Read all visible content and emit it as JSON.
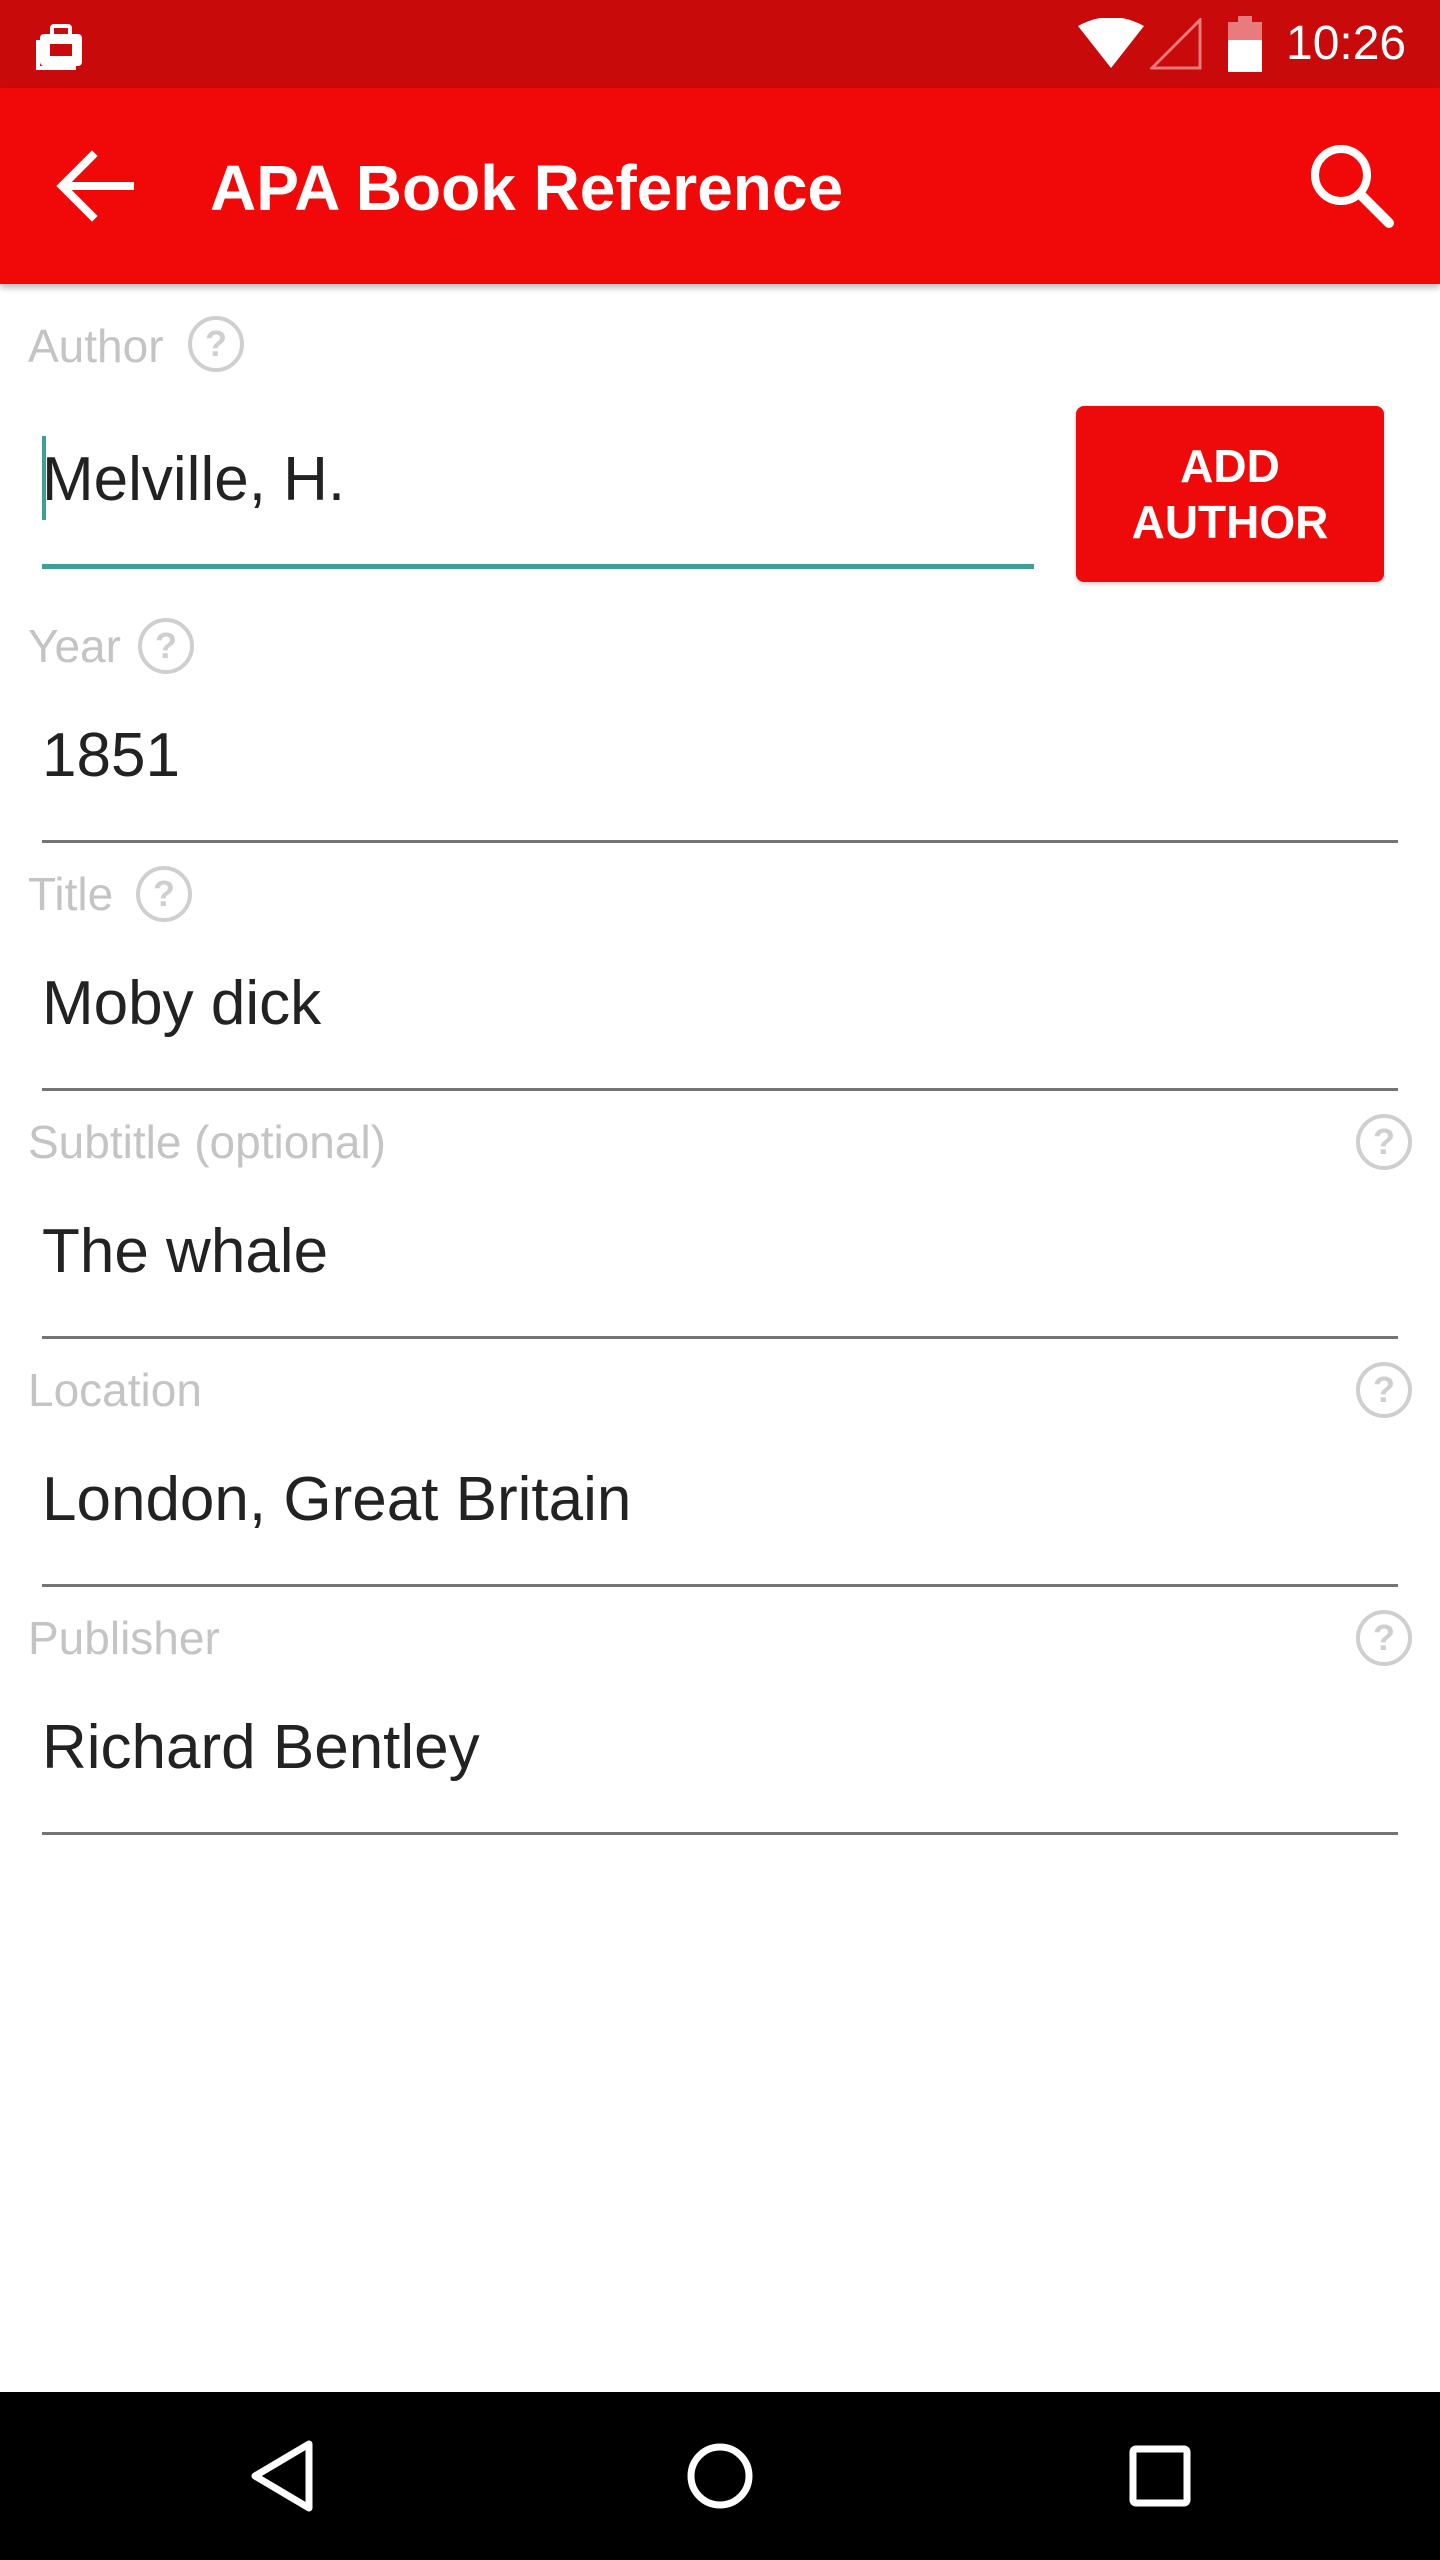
{
  "status_bar": {
    "time": "10:26",
    "icons": [
      "briefcase-notification-icon",
      "wifi-icon",
      "cell-signal-icon",
      "battery-icon"
    ]
  },
  "app_bar": {
    "title": "APA Book Reference",
    "back_icon": "arrow-back-icon",
    "search_icon": "search-icon",
    "background_color": "#f10909",
    "status_color": "#c80a0a"
  },
  "form": {
    "author": {
      "label": "Author",
      "value": "Melville,  H.",
      "help": "?"
    },
    "add_author_button": "ADD AUTHOR",
    "year": {
      "label": "Year",
      "value": "1851",
      "help": "?"
    },
    "title": {
      "label": "Title",
      "value": "Moby dick",
      "help": "?"
    },
    "subtitle": {
      "label": "Subtitle (optional)",
      "value": "The whale",
      "help": "?"
    },
    "location": {
      "label": "Location",
      "value": "London, Great Britain",
      "help": "?"
    },
    "publisher": {
      "label": "Publisher",
      "value": "Richard Bentley",
      "help": "?"
    }
  },
  "nav_bar": {
    "icons": [
      "nav-back-icon",
      "nav-home-icon",
      "nav-recents-icon"
    ]
  },
  "colors": {
    "accent_teal": "#3f9e95",
    "label_gray": "#c4c4c4",
    "button_red": "#ee0a0a"
  }
}
